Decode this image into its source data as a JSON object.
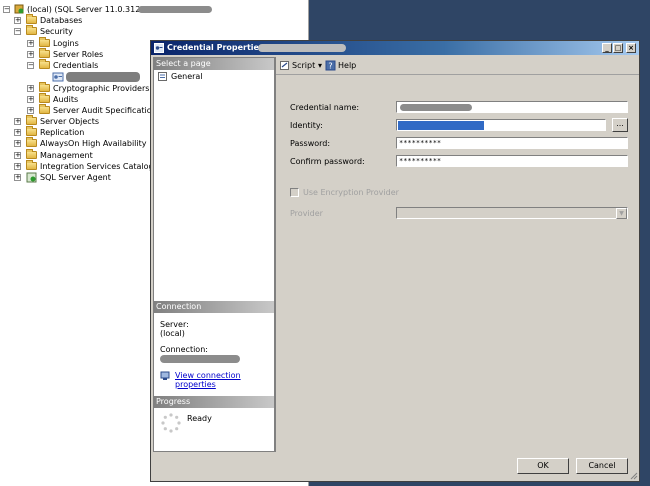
{
  "explorer": {
    "server_label": "(local) (SQL Server 11.0.3128 -",
    "nodes": {
      "databases": "Databases",
      "security": "Security",
      "logins": "Logins",
      "server_roles": "Server Roles",
      "credentials": "Credentials",
      "cryptographic_providers": "Cryptographic Providers",
      "audits": "Audits",
      "server_audit_specifications": "Server Audit Specifications",
      "server_objects": "Server Objects",
      "replication": "Replication",
      "alwayson": "AlwaysOn High Availability",
      "management": "Management",
      "integration_services": "Integration Services Catalogs",
      "sql_agent": "SQL Server Agent"
    },
    "expanders": {
      "plus": "+",
      "minus": "−"
    }
  },
  "dialog": {
    "title": "Credential Properties -",
    "window_buttons": {
      "minimize": "_",
      "maximize": "□",
      "close": "×"
    },
    "select_page_header": "Select a page",
    "pages": [
      "General"
    ],
    "toolbar": {
      "script_label": "Script",
      "script_arrow": "▾",
      "help_label": "Help"
    },
    "connection": {
      "header": "Connection",
      "server_label": "Server:",
      "server_value": "(local)",
      "connection_label": "Connection:",
      "view_link": "View connection properties"
    },
    "progress": {
      "header": "Progress",
      "status": "Ready"
    },
    "form": {
      "credential_name_label": "Credential name:",
      "identity_label": "Identity:",
      "identity_browse": "...",
      "password_label": "Password:",
      "password_value": "**********",
      "confirm_password_label": "Confirm password:",
      "confirm_password_value": "**********",
      "use_encryption_label": "Use Encryption Provider",
      "provider_label": "Provider",
      "provider_value": ""
    },
    "buttons": {
      "ok": "OK",
      "cancel": "Cancel"
    }
  },
  "colors": {
    "desktop": "#2f4565",
    "titlebar_start": "#0a246a",
    "titlebar_end": "#a6caf0",
    "dialog_face": "#d4d0c8",
    "selection": "#316ac5",
    "link": "#0000cc"
  }
}
